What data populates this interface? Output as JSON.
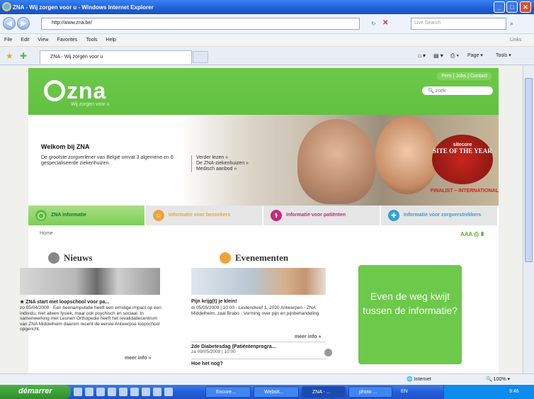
{
  "window": {
    "title": "ZNA - Wij zorgen voor u - Windows Internet Explorer"
  },
  "address": {
    "url": "http://www.zna.be/",
    "search_placeholder": "Live Search"
  },
  "menu": [
    "File",
    "Edit",
    "View",
    "Favorites",
    "Tools",
    "Help"
  ],
  "links_label": "Links",
  "tab": {
    "label": "ZNA - Wij zorgen voor u"
  },
  "commandbar": {
    "page": "Page",
    "tools": "Tools"
  },
  "site": {
    "logo": "zna",
    "tagline": "Wij zorgen voor u",
    "toplinks": "Pers | Jobs | Contact",
    "search_placeholder": "zoek",
    "welcome_title": "Welkom bij ZNA",
    "welcome_text": "De grootste zorgverlener van België omvat 3 algemene en 6 gespecialiseerde ziekenhuizen.",
    "welcome_links": [
      "Verder lezen »",
      "De ZNA-ziekenhuizen »",
      "Medisch aanbod »"
    ],
    "award": {
      "brand": "sitecore",
      "title": "SITE OF THE YEAR",
      "finalist": "FINALIST – INTERNATIONAL"
    },
    "info_tabs": [
      {
        "label": "ZNA informatie",
        "color": "#6cc94a"
      },
      {
        "label": "Informatie voor bezoekers",
        "color": "#f0a23a"
      },
      {
        "label": "Informatie voor patiënten",
        "color": "#c7287a"
      },
      {
        "label": "Informatie voor zorgverstrekkers",
        "color": "#2f9fd0"
      }
    ],
    "breadcrumb": "Home",
    "tools": "AAA",
    "news": {
      "heading": "Nieuws",
      "title": "★ ZNA start met loopschool voor pa...",
      "body": "zo 05/04/2009 · Een beenamputatie heeft een ernstige impact op een individu, niet alleen fysiek, maar ook psychisch en sociaal. In samenwerking met Leunen Orthopedie heeft het revalidatiecentrum van ZNA Middelheim daarom recent de eerste Antwerpse loopschool opgericht.",
      "more": "meer info »"
    },
    "events": {
      "heading": "Evenementen",
      "e1_title": "Pijn krijg(t) je klein!",
      "e1_body": "di 05/05/2009 | 10:00 · Lindendreef 1, 2020 Antwerpen - ZNA Middelheim, zaal Brabo · Vorming over pijn en pijnbehandeling",
      "more": "meer info »",
      "e2_title": "2de Diabetesdag (Patiëntenprogra...",
      "e2_date": "za 09/05/2009 | 10:00",
      "e3_title": "Hoe het nog?"
    },
    "promo": "Even de weg kwijt tussen de informatie?"
  },
  "status": {
    "zone": "Internet",
    "zoom": "100%"
  },
  "taskbar": {
    "start": "démarrer",
    "tasks": [
      "Encore...",
      "Websit...",
      "ZNA - ...",
      "photo ..."
    ],
    "lang": "EN",
    "clock": "9:46"
  }
}
